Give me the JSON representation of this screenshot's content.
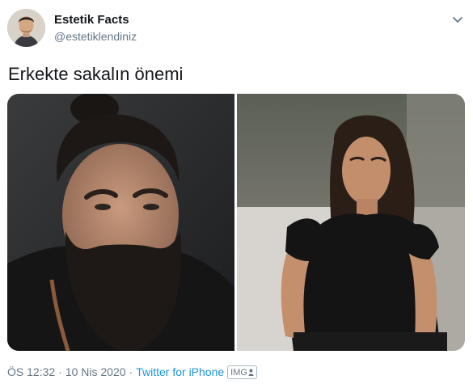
{
  "author": {
    "display_name": "Estetik Facts",
    "handle": "@estetiklendiniz"
  },
  "tweet": {
    "text": "Erkekte sakalın önemi"
  },
  "meta": {
    "time": "ÖS 12:32",
    "separator": "·",
    "date": "10 Nis 2020",
    "source": "Twitter for iPhone",
    "badge": "IMG"
  },
  "icons": {
    "menu": "chevron-down-icon",
    "badge_glyph": "person-silhouette-icon"
  },
  "colors": {
    "link": "#1b95e0",
    "secondary_text": "#657786",
    "primary_text": "#14171a"
  }
}
